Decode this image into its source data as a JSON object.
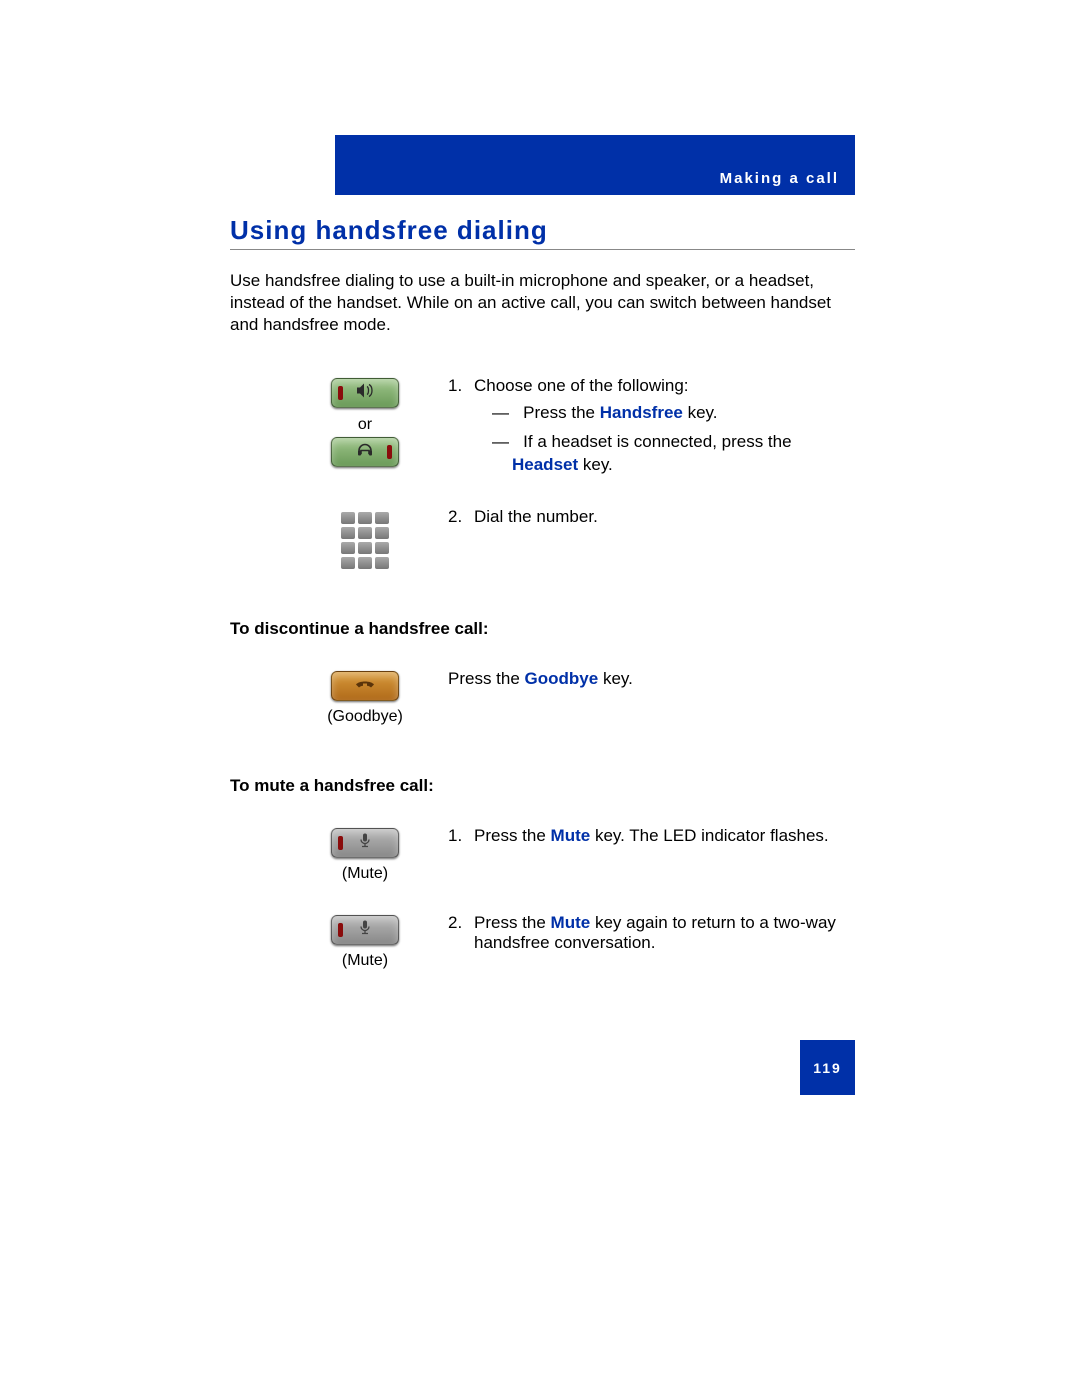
{
  "header": {
    "chapter": "Making a call"
  },
  "section": {
    "title": "Using handsfree dialing",
    "intro": "Use handsfree dialing to use a built-in microphone and speaker, or a headset, instead of the handset. While on an active call, you can switch between handset and handsfree mode."
  },
  "steps": {
    "row1": {
      "or_label": "or",
      "num": "1.",
      "lead": "Choose one of the following:",
      "dash": "—",
      "opt1_pre": "Press the ",
      "opt1_key": "Handsfree",
      "opt1_post": " key.",
      "opt2_pre": "If a headset is connected, press the ",
      "opt2_key": "Headset",
      "opt2_post": " key."
    },
    "row2": {
      "num": "2.",
      "text": "Dial the number."
    }
  },
  "subsections": {
    "discontinue": {
      "heading": "To discontinue a handsfree call:",
      "icon_caption": "(Goodbye)",
      "text_pre": "Press the ",
      "text_key": "Goodbye",
      "text_post": " key."
    },
    "mute": {
      "heading": "To mute a handsfree call:",
      "step1_caption": "(Mute)",
      "step1_num": "1.",
      "step1_pre": "Press the ",
      "step1_key": "Mute",
      "step1_post": " key. The LED indicator flashes.",
      "step2_caption": "(Mute)",
      "step2_num": "2.",
      "step2_pre": "Press the ",
      "step2_key": "Mute",
      "step2_post": " key again to return to a two-way handsfree conversation."
    }
  },
  "page_number": "119"
}
